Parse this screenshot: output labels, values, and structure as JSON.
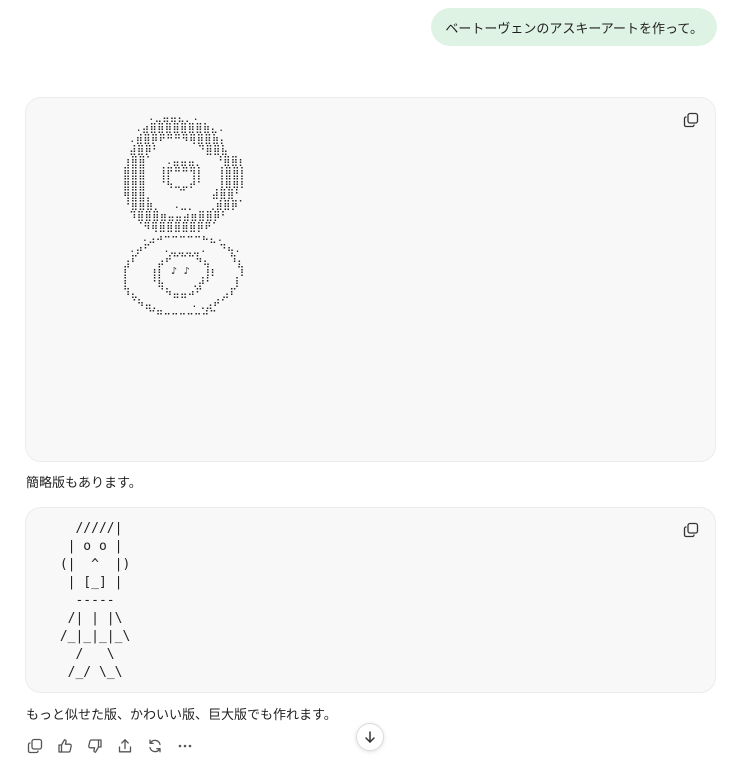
{
  "user_message": "ベートーヴェンのアスキーアートを作って。",
  "assistant": {
    "code_blocks": [
      {
        "content": "       .⣀⣤⣤⣄⡀.\n     .⣴⣿⣿⣿⣿⣿⣿⣿⣷⣄.\n    .⣾⣿⡿⠟⠛⠛⠻⢿⣿⣿⣷⡄\n    ⣼⣿⡿⠃      ⠙⣿⣿⣧\n   ⢰⣿⣿⠁  .⣤⣤⣤⡀  ⠘⣿⣿⡆\n   ⣿⣿⣿  ⢸⡟⠛⠛⢻⡇  ⢸⣿⣿⡇\n   ⣿⣿⣿  ⠘⢧⣀⣀⡼⠃  ⢸⣿⣿⡇\n   ⢿⣿⣿⡀    ⠉    ⣼⣿⣿⠃\n   ⠘⣿⣿⣷⡀  .⣀⡀  ⢀⣾⣿⡿⠁\n    ⠹⣿⣿⣿⣶⣤⣤⣴⣶⣿⣿⡿⠃\n     ⠈⠻⢿⣿⣿⣿⣿⣿⡿⠟⠁\n      .⣠⠴⠒⠒⠒⠒⠒⠦⣄.\n    .⡴⠋  .⣀⣀⣀⣀.  ⠙⢦.\n   ⢠⠏   ⣠⠞⠉⠉⠉⠳⣄   ⠹⡄\n   ⡏   ⢰⡇ ♪ ♪  ⢸⡆   ⢹\n   ⡇   ⠘⣧    ⢀⡼⠃   ⢸\n   ⠹⣄   ⠈⠳⣤⣤⠴⠋   ⣠⠏\n    ⠈⠳⣤⡀     .⢀⣠⠞⠁\n       ⠉⠛⠒⠒⠒⠒⠒⠚⠉"
      },
      {
        "content": "   /////|\n  | o o |\n (|  ^  |)\n  | [_] |\n   -----\n  /| | |\\\n /_|_|_|_\\\n   /   \\\n  /_/ \\_\\"
      }
    ],
    "paragraphs": [
      "簡略版もあります。",
      "もっと似せた版、かわいい版、巨大版でも作れます。"
    ]
  },
  "actions": [
    "copy",
    "thumbs-up",
    "thumbs-down",
    "share",
    "regenerate",
    "more"
  ]
}
